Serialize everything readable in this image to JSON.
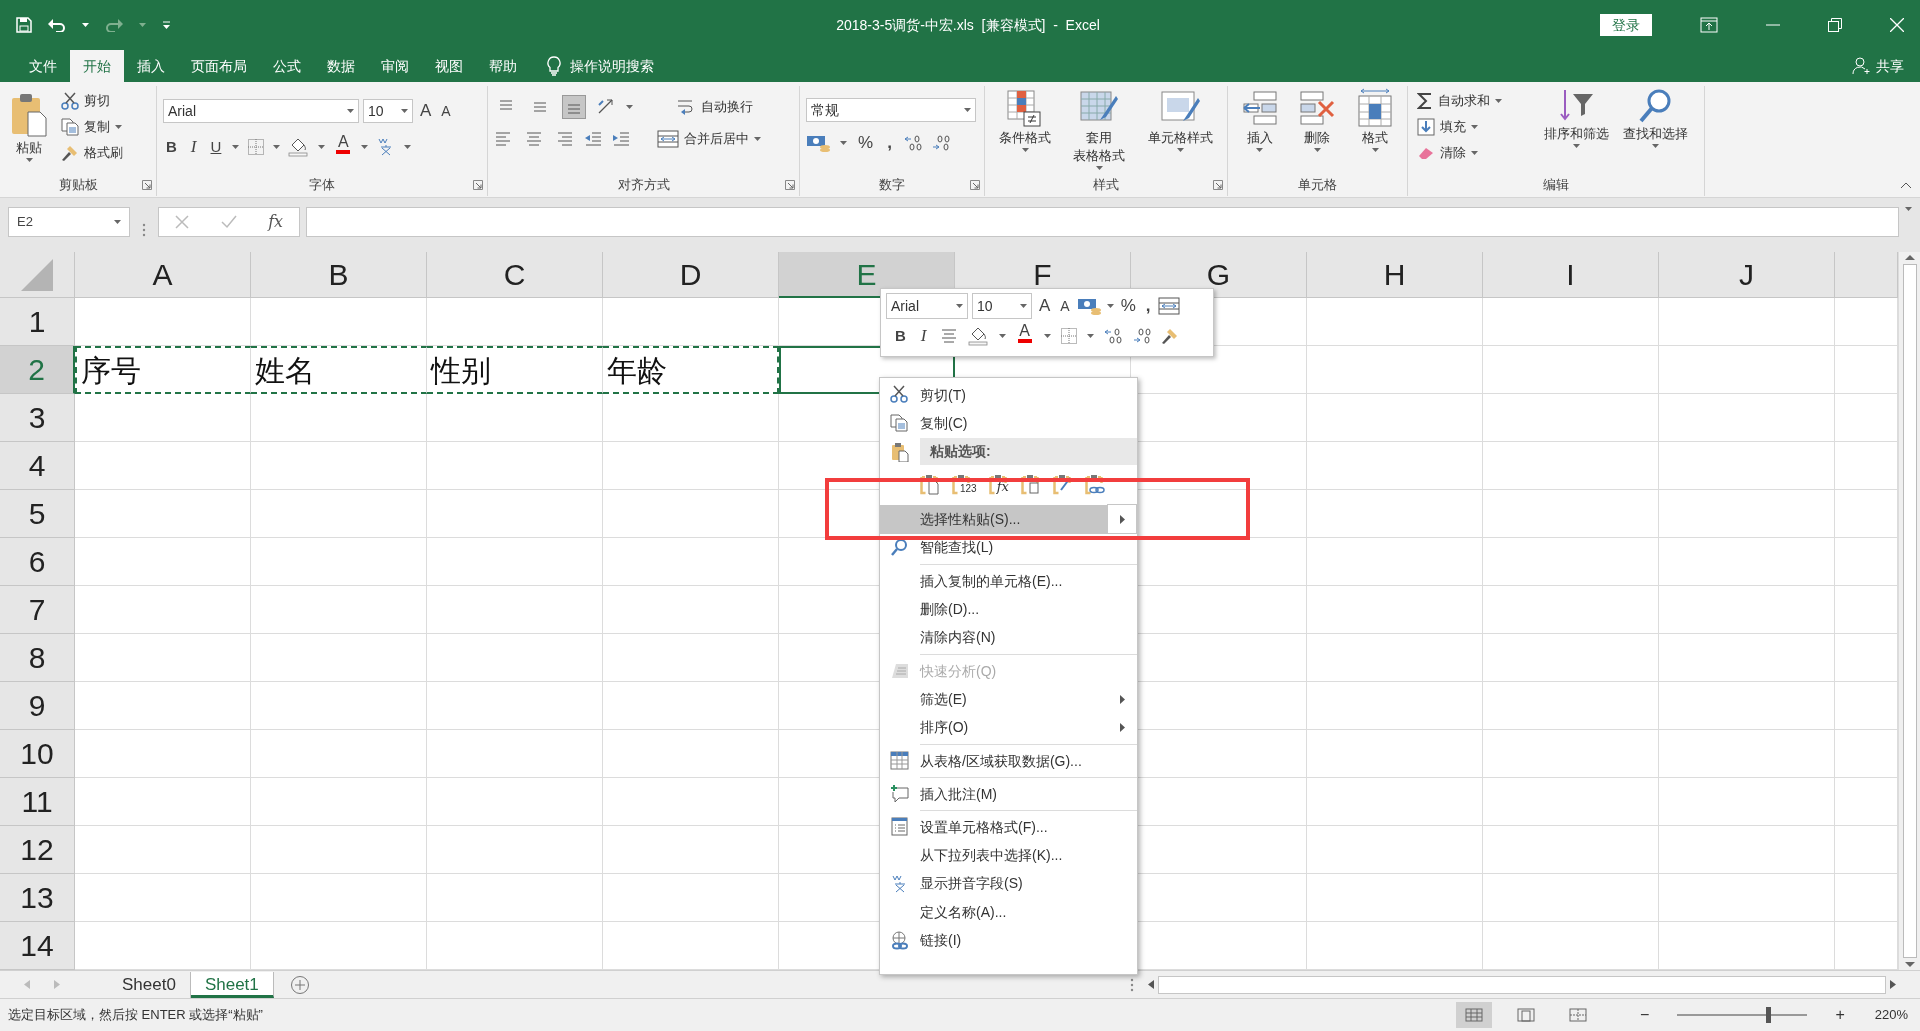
{
  "window": {
    "title": "2018-3-5调货-中宏.xls  [兼容模式]  -  Excel",
    "login_button": "登录"
  },
  "ribbon_tabs": [
    {
      "label": "文件",
      "selected": false
    },
    {
      "label": "开始",
      "selected": true
    },
    {
      "label": "插入",
      "selected": false
    },
    {
      "label": "页面布局",
      "selected": false
    },
    {
      "label": "公式",
      "selected": false
    },
    {
      "label": "数据",
      "selected": false
    },
    {
      "label": "审阅",
      "selected": false
    },
    {
      "label": "视图",
      "selected": false
    },
    {
      "label": "帮助",
      "selected": false
    }
  ],
  "tell_me": "操作说明搜索",
  "share": "共享",
  "ribbon": {
    "clipboard": {
      "label": "剪贴板",
      "paste": "粘贴",
      "cut": "剪切",
      "copy": "复制",
      "format_painter": "格式刷"
    },
    "font": {
      "label": "字体",
      "font_name": "Arial",
      "font_size": "10",
      "grow_font": "A",
      "shrink_font": "A",
      "bold": "B",
      "italic": "I",
      "underline": "U",
      "font_color": "A"
    },
    "alignment": {
      "label": "对齐方式",
      "wrap_text": "自动换行",
      "merge_center": "合并后居中",
      "vertical_align": [
        {
          "selected": false
        },
        {
          "selected": false
        },
        {
          "selected": true
        }
      ]
    },
    "number": {
      "label": "数字",
      "format": "常规",
      "percent": "%",
      "comma": ","
    },
    "styles": {
      "label": "样式",
      "buttons": [
        [
          "条件格式"
        ],
        [
          "套用",
          "表格格式"
        ],
        [
          "单元格样式"
        ]
      ]
    },
    "cells": {
      "label": "单元格",
      "buttons": [
        "插入",
        "删除",
        "格式"
      ]
    },
    "editing": {
      "label": "编辑",
      "autosum": "自动求和",
      "fill": "填充",
      "clear": "清除",
      "sort_filter": "排序和筛选",
      "find_select": "查找和选择"
    }
  },
  "formula_bar": {
    "name_box": "E2",
    "function_label": "fx"
  },
  "sheet": {
    "columns": [
      {
        "label": "A",
        "selected": false
      },
      {
        "label": "B",
        "selected": false
      },
      {
        "label": "C",
        "selected": false
      },
      {
        "label": "D",
        "selected": false
      },
      {
        "label": "E",
        "selected": true
      },
      {
        "label": "F",
        "selected": false
      },
      {
        "label": "G",
        "selected": false
      },
      {
        "label": "H",
        "selected": false
      },
      {
        "label": "I",
        "selected": false
      },
      {
        "label": "J",
        "selected": false
      }
    ],
    "rows": [
      {
        "header": "1",
        "selected": false
      },
      {
        "header": "2",
        "selected": true,
        "copied": true,
        "cells": [
          "序号",
          "姓名",
          "性别",
          "年龄"
        ]
      },
      {
        "header": "3",
        "selected": false
      },
      {
        "header": "4",
        "selected": false
      },
      {
        "header": "5",
        "selected": false
      },
      {
        "header": "6",
        "selected": false
      },
      {
        "header": "7",
        "selected": false
      },
      {
        "header": "8",
        "selected": false
      },
      {
        "header": "9",
        "selected": false
      },
      {
        "header": "10",
        "selected": false
      },
      {
        "header": "11",
        "selected": false
      },
      {
        "header": "12",
        "selected": false
      },
      {
        "header": "13",
        "selected": false
      },
      {
        "header": "14",
        "selected": false
      }
    ]
  },
  "mini_toolbar": {
    "font_name": "Arial",
    "font_size": "10",
    "grow_font": "A",
    "shrink_font": "A",
    "percent": "%",
    "comma": ",",
    "bold": "B",
    "italic": "I",
    "font_color": "A"
  },
  "context_menu": {
    "items": [
      {
        "kind": "item",
        "label": "剪切(T)",
        "selected": false,
        "disabled": false,
        "submenu": false,
        "divider": false
      },
      {
        "kind": "item",
        "label": "复制(C)",
        "selected": false,
        "disabled": false,
        "submenu": false,
        "divider": false
      },
      {
        "kind": "header",
        "label": "粘贴选项:"
      },
      {
        "kind": "paste_options",
        "options": [
          {
            "kind": "paste"
          },
          {
            "kind": "values",
            "label": "123"
          },
          {
            "kind": "formulas",
            "label": "fx"
          },
          {
            "kind": "transpose"
          },
          {
            "kind": "formatting"
          },
          {
            "kind": "link"
          }
        ]
      },
      {
        "kind": "item",
        "label": "选择性粘贴(S)...",
        "selected": true,
        "disabled": false,
        "submenu": true,
        "divider": false
      },
      {
        "kind": "item",
        "label": "智能查找(L)",
        "selected": false,
        "disabled": false,
        "submenu": false,
        "divider": false
      },
      {
        "kind": "item",
        "label": "插入复制的单元格(E)...",
        "selected": false,
        "disabled": false,
        "submenu": false,
        "divider": true
      },
      {
        "kind": "item",
        "label": "删除(D)...",
        "selected": false,
        "disabled": false,
        "submenu": false,
        "divider": false
      },
      {
        "kind": "item",
        "label": "清除内容(N)",
        "selected": false,
        "disabled": false,
        "submenu": false,
        "divider": false
      },
      {
        "kind": "item",
        "label": "快速分析(Q)",
        "selected": false,
        "disabled": true,
        "submenu": false,
        "divider": true
      },
      {
        "kind": "item",
        "label": "筛选(E)",
        "selected": false,
        "disabled": false,
        "submenu": true,
        "divider": false
      },
      {
        "kind": "item",
        "label": "排序(O)",
        "selected": false,
        "disabled": false,
        "submenu": true,
        "divider": false
      },
      {
        "kind": "item",
        "label": "从表格/区域获取数据(G)...",
        "selected": false,
        "disabled": false,
        "submenu": false,
        "divider": true
      },
      {
        "kind": "item",
        "label": "插入批注(M)",
        "selected": false,
        "disabled": false,
        "submenu": false,
        "divider": true
      },
      {
        "kind": "item",
        "label": "设置单元格格式(F)...",
        "selected": false,
        "disabled": false,
        "submenu": false,
        "divider": true
      },
      {
        "kind": "item",
        "label": "从下拉列表中选择(K)...",
        "selected": false,
        "disabled": false,
        "submenu": false,
        "divider": false
      },
      {
        "kind": "item",
        "label": "显示拼音字段(S)",
        "selected": false,
        "disabled": false,
        "submenu": false,
        "divider": false
      },
      {
        "kind": "item",
        "label": "定义名称(A)...",
        "selected": false,
        "disabled": false,
        "submenu": false,
        "divider": false
      },
      {
        "kind": "item",
        "label": "链接(I)",
        "selected": false,
        "disabled": false,
        "submenu": false,
        "divider": false
      }
    ]
  },
  "sheet_tabs": [
    {
      "label": "Sheet0",
      "selected": false
    },
    {
      "label": "Sheet1",
      "selected": true
    }
  ],
  "status_bar": {
    "message": "选定目标区域，然后按 ENTER 或选择“粘贴”",
    "views": [
      {
        "selected": true
      },
      {
        "selected": false
      },
      {
        "selected": false
      }
    ],
    "zoom_out": "−",
    "zoom_slider": {
      "level": 0.7
    },
    "zoom_in": "+",
    "zoom": "220%"
  }
}
